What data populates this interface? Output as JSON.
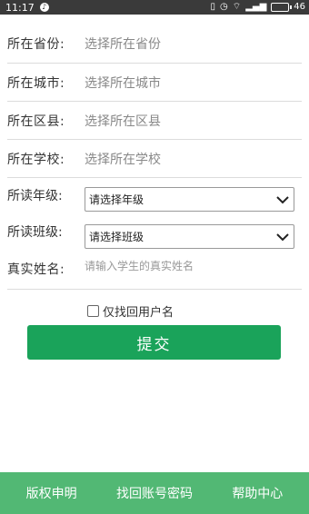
{
  "status_bar": {
    "time": "11:17",
    "battery_level": "46"
  },
  "form": {
    "province": {
      "label": "所在省份:",
      "value": "选择所在省份"
    },
    "city": {
      "label": "所在城市:",
      "value": "选择所在城市"
    },
    "district": {
      "label": "所在区县:",
      "value": "选择所在区县"
    },
    "school": {
      "label": "所在学校:",
      "value": "选择所在学校"
    },
    "grade": {
      "label": "所读年级:",
      "selected": "请选择年级"
    },
    "class": {
      "label": "所读班级:",
      "selected": "请选择班级"
    },
    "name": {
      "label": "真实姓名:",
      "placeholder": "请输入学生的真实姓名"
    },
    "username_only": {
      "label": "仅找回用户名",
      "checked": false
    },
    "submit_label": "提交"
  },
  "footer": {
    "items": [
      {
        "label": "版权申明"
      },
      {
        "label": "找回账号密码"
      },
      {
        "label": "帮助中心"
      }
    ]
  },
  "colors": {
    "accent": "#1aa35a",
    "footer_bg": "#52b874",
    "status_bar_bg": "#3a3a3a"
  }
}
